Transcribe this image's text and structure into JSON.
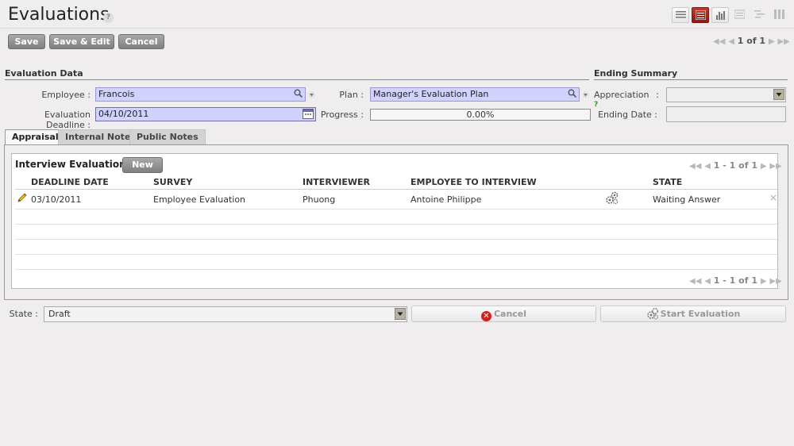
{
  "header": {
    "title": "Evaluations",
    "help": "?"
  },
  "toolbar": {
    "save": "Save",
    "save_edit": "Save & Edit",
    "cancel": "Cancel"
  },
  "pager": {
    "text": "1 of 1"
  },
  "sections": {
    "evaluation_data": "Evaluation Data",
    "ending_summary": "Ending Summary"
  },
  "form": {
    "employee_label": "Employee :",
    "employee_value": "Francois",
    "plan_label": "Plan :",
    "plan_value": "Manager's Evaluation Plan",
    "deadline_label": "Evaluation Deadline :",
    "deadline_value": "04/10/2011",
    "progress_label": "Progress :",
    "progress_value": "0.00%",
    "appreciation_label": "Appreciation",
    "appreciation_help": "?",
    "appreciation_colon": ":",
    "ending_date_label": "Ending Date :"
  },
  "tabs": [
    {
      "label": "Appraisal"
    },
    {
      "label": "Internal Notes"
    },
    {
      "label": "Public Notes"
    }
  ],
  "interview": {
    "title": "Interview Evaluation",
    "new_button": "New",
    "pager_top": "1 - 1 of 1",
    "pager_bottom": "1 - 1 of 1",
    "columns": [
      "DEADLINE DATE",
      "SURVEY",
      "INTERVIEWER",
      "EMPLOYEE TO INTERVIEW",
      "STATE"
    ],
    "rows": [
      {
        "deadline": "03/10/2011",
        "survey": "Employee Evaluation",
        "interviewer": "Phuong",
        "employee": "Antoine Philippe",
        "state": "Waiting Answer",
        "delete": "×"
      }
    ]
  },
  "footer": {
    "state_label": "State :",
    "state_value": "Draft",
    "cancel_button": "Cancel",
    "start_button": "Start Evaluation"
  }
}
